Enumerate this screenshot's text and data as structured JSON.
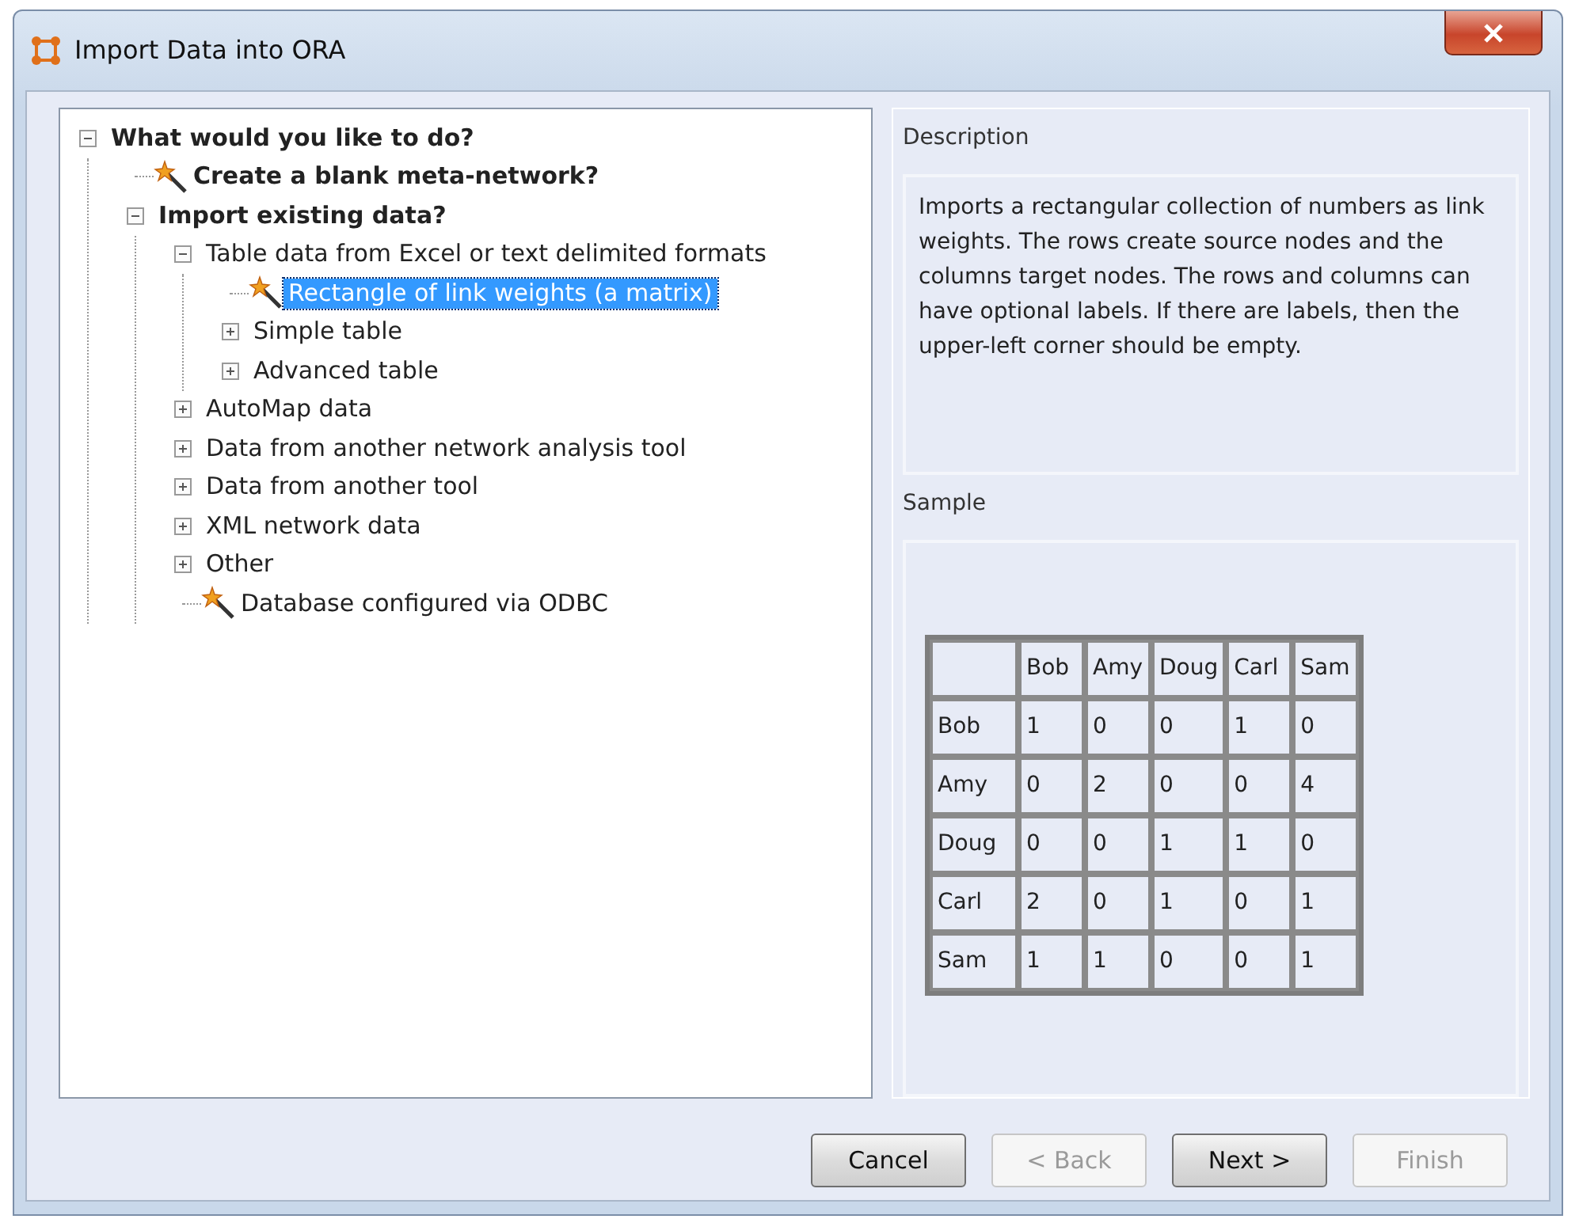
{
  "window": {
    "title": "Import Data into ORA"
  },
  "tree": [
    {
      "label": "What would you like to do?",
      "kind": "group",
      "bold": true,
      "expanded": true,
      "selected": false,
      "children": [
        {
          "label": "Create a blank meta-network?",
          "kind": "action",
          "bold": true,
          "selected": false
        },
        {
          "label": "Import existing data?",
          "kind": "group",
          "bold": true,
          "expanded": true,
          "selected": false,
          "children": [
            {
              "label": "Table data from Excel or text delimited formats",
              "kind": "group",
              "bold": false,
              "expanded": true,
              "selected": false,
              "children": [
                {
                  "label": "Rectangle of link weights (a matrix)",
                  "kind": "action",
                  "bold": false,
                  "selected": true
                },
                {
                  "label": "Simple table",
                  "kind": "group",
                  "bold": false,
                  "expanded": false,
                  "selected": false
                },
                {
                  "label": "Advanced table",
                  "kind": "group",
                  "bold": false,
                  "expanded": false,
                  "selected": false
                }
              ]
            },
            {
              "label": "AutoMap data",
              "kind": "group",
              "bold": false,
              "expanded": false,
              "selected": false
            },
            {
              "label": "Data from another network analysis tool",
              "kind": "group",
              "bold": false,
              "expanded": false,
              "selected": false
            },
            {
              "label": "Data from another tool",
              "kind": "group",
              "bold": false,
              "expanded": false,
              "selected": false
            },
            {
              "label": "XML network data",
              "kind": "group",
              "bold": false,
              "expanded": false,
              "selected": false
            },
            {
              "label": "Other",
              "kind": "group",
              "bold": false,
              "expanded": false,
              "selected": false
            },
            {
              "label": "Database configured via ODBC",
              "kind": "action",
              "bold": false,
              "selected": false
            }
          ]
        }
      ]
    }
  ],
  "description": {
    "title": "Description",
    "text": "Imports a rectangular collection of numbers as link weights. The rows create source nodes and the columns target nodes. The rows and columns can have optional labels. If there are labels, then the upper-left corner should be empty."
  },
  "sample": {
    "title": "Sample",
    "columns": [
      "",
      "Bob",
      "Amy",
      "Doug",
      "Carl",
      "Sam"
    ],
    "rows": [
      [
        "Bob",
        "1",
        "0",
        "0",
        "1",
        "0"
      ],
      [
        "Amy",
        "0",
        "2",
        "0",
        "0",
        "4"
      ],
      [
        "Doug",
        "0",
        "0",
        "1",
        "1",
        "0"
      ],
      [
        "Carl",
        "2",
        "0",
        "1",
        "0",
        "1"
      ],
      [
        "Sam",
        "1",
        "1",
        "0",
        "0",
        "1"
      ]
    ]
  },
  "buttons": [
    {
      "label": "Cancel",
      "disabled": false
    },
    {
      "label": "< Back",
      "disabled": true
    },
    {
      "label": "Next >",
      "disabled": false
    },
    {
      "label": "Finish",
      "disabled": true
    }
  ]
}
